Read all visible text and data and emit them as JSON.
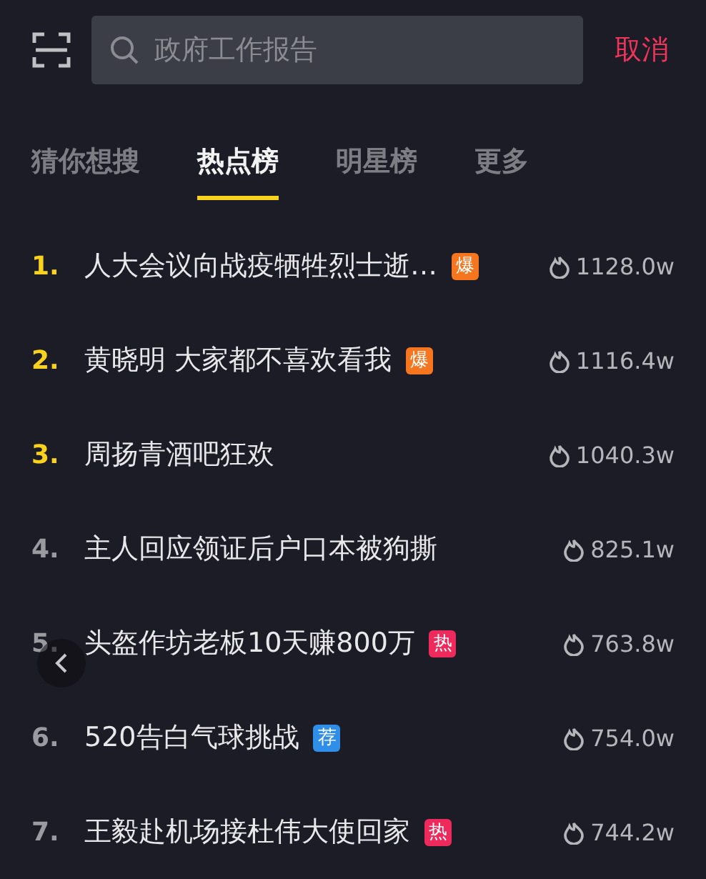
{
  "search": {
    "placeholder": "政府工作报告",
    "cancel": "取消"
  },
  "tabs": [
    {
      "label": "猜你想搜",
      "selected": false
    },
    {
      "label": "热点榜",
      "selected": true
    },
    {
      "label": "明星榜",
      "selected": false
    },
    {
      "label": "更多",
      "selected": false
    }
  ],
  "items": [
    {
      "rank": "1.",
      "top": true,
      "title": "人大会议向战疫牺牲烈士逝…",
      "badge": {
        "kind": "burst",
        "text": "爆"
      },
      "count": "1128.0w"
    },
    {
      "rank": "2.",
      "top": true,
      "title": "黄晓明 大家都不喜欢看我",
      "badge": {
        "kind": "burst",
        "text": "爆"
      },
      "count": "1116.4w"
    },
    {
      "rank": "3.",
      "top": true,
      "title": "周扬青酒吧狂欢",
      "count": "1040.3w"
    },
    {
      "rank": "4.",
      "top": false,
      "title": "主人回应领证后户口本被狗撕",
      "count": "825.1w"
    },
    {
      "rank": "5.",
      "top": false,
      "title": "头盔作坊老板10天赚800万",
      "badge": {
        "kind": "hot",
        "text": "热"
      },
      "count": "763.8w"
    },
    {
      "rank": "6.",
      "top": false,
      "title": "520告白气球挑战",
      "badge": {
        "kind": "recommended",
        "text": "荐"
      },
      "count": "754.0w"
    },
    {
      "rank": "7.",
      "top": false,
      "title": "王毅赴机场接杜伟大使回家",
      "badge": {
        "kind": "hot",
        "text": "热"
      },
      "count": "744.2w"
    }
  ]
}
